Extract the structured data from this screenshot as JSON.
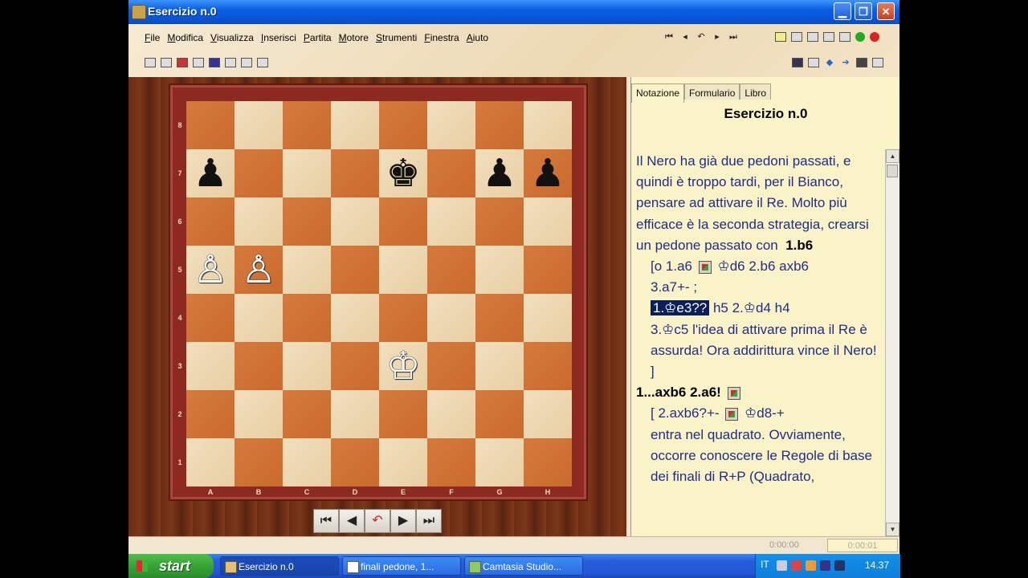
{
  "window": {
    "title": "Esercizio n.0",
    "minimize": "▁",
    "restore": "❐",
    "close": "✕"
  },
  "menu": [
    "File",
    "Modifica",
    "Visualizza",
    "Inserisci",
    "Partita",
    "Motore",
    "Strumenti",
    "Finestra",
    "Aiuto"
  ],
  "board": {
    "ranks": [
      "8",
      "7",
      "6",
      "5",
      "4",
      "3",
      "2",
      "1"
    ],
    "files": [
      "A",
      "B",
      "C",
      "D",
      "E",
      "F",
      "G",
      "H"
    ],
    "pieces": [
      {
        "square": "a7",
        "glyph": "♟",
        "color": "black",
        "name": "black-pawn-a7"
      },
      {
        "square": "e7",
        "glyph": "♚",
        "color": "black",
        "name": "black-king-e7"
      },
      {
        "square": "g7",
        "glyph": "♟",
        "color": "black",
        "name": "black-pawn-g7"
      },
      {
        "square": "h7",
        "glyph": "♟",
        "color": "black",
        "name": "black-pawn-h7"
      },
      {
        "square": "a5",
        "glyph": "♙",
        "color": "white",
        "name": "white-pawn-a5"
      },
      {
        "square": "b5",
        "glyph": "♙",
        "color": "white",
        "name": "white-pawn-b5"
      },
      {
        "square": "e3",
        "glyph": "♔",
        "color": "white",
        "name": "white-king-e3"
      }
    ]
  },
  "nav": {
    "first": "⏮",
    "back": "◀",
    "takeback": "↶",
    "forward": "▶",
    "last": "⏭"
  },
  "panel": {
    "tabs": [
      "Notazione",
      "Formulario",
      "Libro"
    ],
    "title": "Esercizio n.0",
    "text": {
      "p1": "Il Nero ha già due pedoni passati, e quindi è troppo tardi, per il Bianco, pensare ad attivare il Re. Molto più efficace è la seconda strategia, crearsi un pedone passato con",
      "p1_move": "1.b6",
      "v1a": "[o  1.a6",
      "v1b": "♔d6  2.b6  axb6",
      "v1c": "3.a7+- ;",
      "v2_hl": "1.♔e3??",
      "v2_rest": " h5  2.♔d4  h4",
      "v2c": "3.♔c5 l'idea di attivare prima il Re è assurda! Ora addirittura vince il Nero! ]",
      "main2": "1...axb6  2.a6!",
      "v3a": "[ 2.axb6?+-",
      "v3b": "♔d8-+",
      "v3c": "entra nel quadrato. Ovviamente, occorre conoscere le Regole di base dei finali di R+P (Quadrato,"
    }
  },
  "timer": {
    "t1": "0:00:00",
    "t2": "0:00:01"
  },
  "taskbar": {
    "start": "start",
    "tasks": [
      "Esercizio n.0",
      "finali pedone,  1...",
      "Camtasia Studio..."
    ],
    "lang": "IT",
    "clock": "14.37"
  }
}
